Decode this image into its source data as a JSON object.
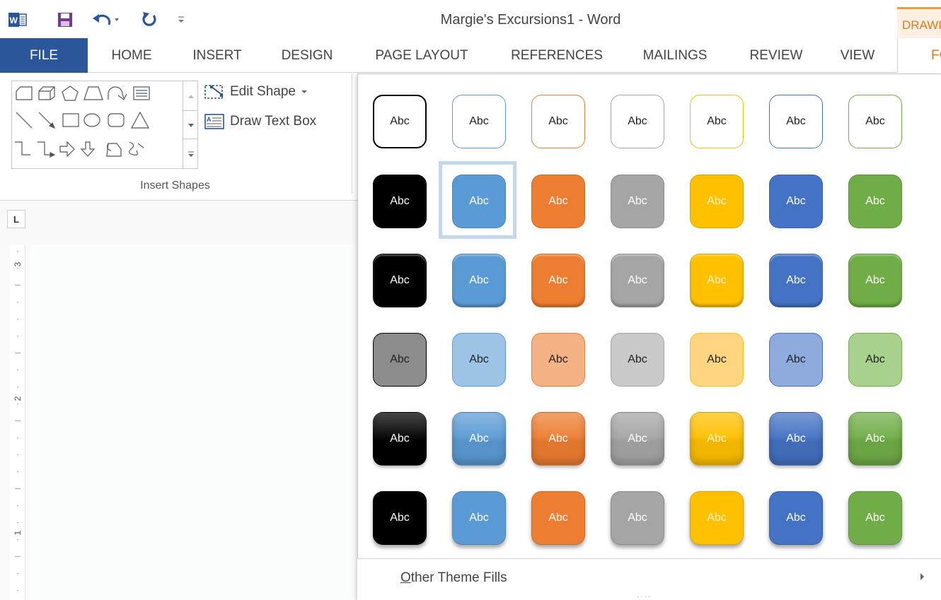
{
  "window": {
    "title": "Margie's Excursions1 - Word",
    "contextual_tab_header": "DRAWING TOOLS"
  },
  "quick_access": {
    "icons": [
      "word-logo-icon",
      "save-icon",
      "undo-icon",
      "redo-icon",
      "customize-qat-icon"
    ]
  },
  "tabs": [
    {
      "label": "FILE"
    },
    {
      "label": "HOME"
    },
    {
      "label": "INSERT"
    },
    {
      "label": "DESIGN"
    },
    {
      "label": "PAGE LAYOUT"
    },
    {
      "label": "REFERENCES"
    },
    {
      "label": "MAILINGS"
    },
    {
      "label": "REVIEW"
    },
    {
      "label": "VIEW"
    },
    {
      "label": "FORMAT"
    }
  ],
  "ribbon": {
    "edit_shape": "Edit Shape",
    "draw_text_box": "Draw Text Box",
    "group_label": "Insert Shapes"
  },
  "ruler": {
    "tab_selector": "L",
    "numbers": [
      "3",
      "2",
      "1"
    ]
  },
  "gallery": {
    "tile_label": "Abc",
    "colors": [
      "#000000",
      "#5b9bd5",
      "#ed7d31",
      "#a5a5a5",
      "#ffc000",
      "#4472c4",
      "#70ad47"
    ],
    "light_colors": [
      "#8c8c8c",
      "#9dc3e6",
      "#f4b183",
      "#c9c9c9",
      "#ffd580",
      "#8faadc",
      "#a9d18e"
    ],
    "row_styles": [
      "outline",
      "fill",
      "bevel",
      "light",
      "gloss",
      "shadowy"
    ],
    "selected": {
      "row": 2,
      "col": 2
    },
    "other_fills_prefix": "O",
    "other_fills_rest": "ther Theme Fills"
  }
}
